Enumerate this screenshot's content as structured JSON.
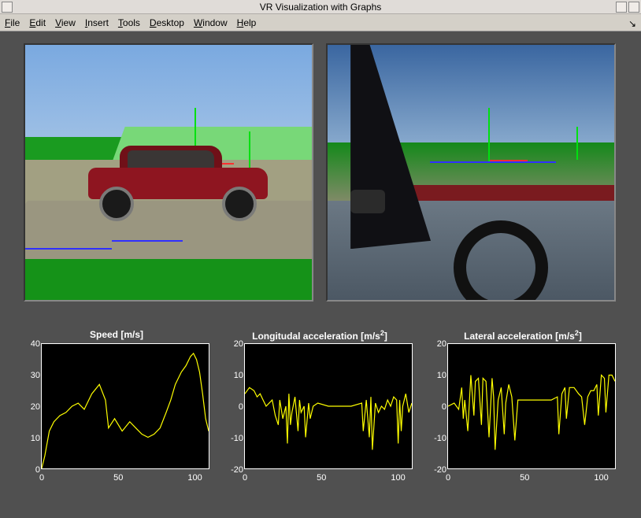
{
  "window": {
    "title": "VR Visualization with Graphs"
  },
  "menubar": {
    "items": [
      {
        "label": "File",
        "u": 0
      },
      {
        "label": "Edit",
        "u": 0
      },
      {
        "label": "View",
        "u": 0
      },
      {
        "label": "Insert",
        "u": 0
      },
      {
        "label": "Tools",
        "u": 0
      },
      {
        "label": "Desktop",
        "u": 0
      },
      {
        "label": "Window",
        "u": 0
      },
      {
        "label": "Help",
        "u": 0
      }
    ]
  },
  "viewports": {
    "exterior": {
      "name": "exterior-camera"
    },
    "interior": {
      "name": "driver-camera"
    }
  },
  "chart_data": [
    {
      "type": "line",
      "title": "Speed [m/s]",
      "xlabel": "",
      "ylabel": "",
      "xlim": [
        0,
        110
      ],
      "ylim": [
        0,
        40
      ],
      "yticks": [
        0,
        10,
        20,
        30,
        40
      ],
      "xticks": [
        0,
        50,
        100
      ],
      "x": [
        0,
        2,
        5,
        8,
        12,
        16,
        20,
        24,
        28,
        33,
        38,
        42,
        44,
        48,
        53,
        58,
        62,
        66,
        70,
        74,
        78,
        82,
        85,
        88,
        92,
        95,
        98,
        100,
        102,
        104,
        106,
        108,
        110
      ],
      "values": [
        0,
        4,
        12,
        15,
        17,
        18,
        20,
        21,
        19,
        24,
        27,
        22,
        13,
        16,
        12,
        15,
        13,
        11,
        10,
        11,
        13,
        18,
        22,
        27,
        31,
        33,
        36,
        37,
        35,
        31,
        24,
        16,
        12
      ]
    },
    {
      "type": "line",
      "title": "Longitudal acceleration [m/s²]",
      "title_html": "Longitudal acceleration [m/s<sup>2</sup>]",
      "xlabel": "",
      "ylabel": "",
      "xlim": [
        0,
        110
      ],
      "ylim": [
        -20,
        20
      ],
      "yticks": [
        -20,
        -10,
        0,
        10,
        20
      ],
      "xticks": [
        0,
        50,
        100
      ],
      "x": [
        0,
        3,
        6,
        8,
        10,
        12,
        14,
        16,
        18,
        20,
        22,
        23,
        25,
        27,
        28,
        29,
        30,
        31,
        33,
        35,
        36,
        37,
        39,
        40,
        42,
        43,
        45,
        48,
        55,
        62,
        70,
        77,
        78,
        80,
        82,
        83,
        84,
        86,
        88,
        90,
        92,
        94,
        96,
        98,
        100,
        101,
        102,
        103,
        104,
        106,
        108,
        110
      ],
      "values": [
        4,
        6,
        5,
        3,
        4,
        2,
        0,
        1,
        2,
        -3,
        -6,
        2,
        -4,
        0,
        -12,
        4,
        -6,
        -2,
        3,
        -8,
        2,
        -2,
        0,
        -10,
        1,
        -4,
        0,
        1,
        0,
        0,
        0,
        1,
        -8,
        2,
        -10,
        3,
        -14,
        1,
        -2,
        0,
        -1,
        2,
        0,
        3,
        2,
        -12,
        2,
        -8,
        0,
        4,
        -2,
        1
      ]
    },
    {
      "type": "line",
      "title": "Lateral acceleration [m/s²]",
      "title_html": "Lateral acceleration [m/s<sup>2</sup>]",
      "xlabel": "",
      "ylabel": "",
      "xlim": [
        0,
        110
      ],
      "ylim": [
        -20,
        20
      ],
      "yticks": [
        -20,
        -10,
        0,
        10,
        20
      ],
      "xticks": [
        0,
        50,
        100
      ],
      "x": [
        0,
        4,
        7,
        9,
        10,
        11,
        13,
        15,
        17,
        18,
        20,
        22,
        23,
        25,
        27,
        29,
        30,
        31,
        33,
        35,
        37,
        38,
        40,
        42,
        44,
        46,
        50,
        56,
        62,
        68,
        72,
        73,
        75,
        77,
        78,
        80,
        83,
        86,
        88,
        90,
        92,
        94,
        96,
        98,
        99,
        101,
        103,
        104,
        106,
        108,
        110
      ],
      "values": [
        0,
        1,
        -1,
        6,
        -4,
        2,
        -8,
        10,
        -3,
        8,
        9,
        -6,
        9,
        8,
        -10,
        9,
        3,
        -14,
        2,
        6,
        -9,
        1,
        7,
        3,
        -11,
        2,
        2,
        2,
        2,
        2,
        3,
        -9,
        4,
        6,
        -4,
        6,
        6,
        4,
        3,
        -6,
        3,
        5,
        5,
        7,
        -3,
        10,
        9,
        -2,
        10,
        10,
        8
      ]
    }
  ]
}
